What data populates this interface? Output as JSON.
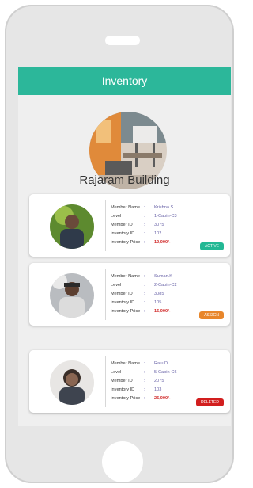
{
  "app": {
    "title": "Inventory"
  },
  "building": {
    "name": "Rajaram Building"
  },
  "labels": {
    "member_name": "Member Name",
    "level": "Level",
    "member_id": "Member ID",
    "inventory_id": "Inventory ID",
    "inventory_price": "Inventory Price",
    "colon": ":"
  },
  "members": [
    {
      "name": "Krishna.S",
      "level": "1-Cabin-C3",
      "member_id": "3075",
      "inventory_id": "102",
      "price": "10,000/-",
      "status": "ACTIVE",
      "status_color": "#22b894"
    },
    {
      "name": "Suman.K",
      "level": "2-Cabin-C2",
      "member_id": "3085",
      "inventory_id": "105",
      "price": "15,000/-",
      "status": "ASSIGN",
      "status_color": "#e8862b"
    },
    {
      "name": "Raju.D",
      "level": "5-Cabin-C6",
      "member_id": "2075",
      "inventory_id": "103",
      "price": "25,000/-",
      "status": "DELETED",
      "status_color": "#d21e1e"
    }
  ],
  "colors": {
    "header": "#2cb79a",
    "value_text": "#6a64a8",
    "price_text": "#d12a2a"
  },
  "icons": {
    "building_photo": "office-building-photo",
    "member_avatar": "member-avatar-photo"
  }
}
